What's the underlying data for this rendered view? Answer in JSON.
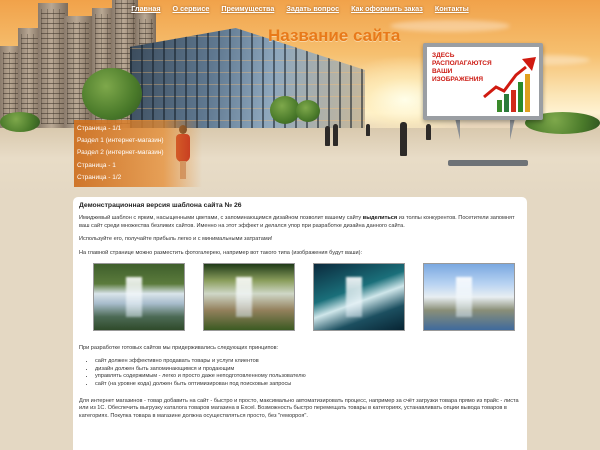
{
  "nav": {
    "items": [
      "Главная",
      "О сервисе",
      "Преимущества",
      "Задать вопрос",
      "Как оформить заказ",
      "Контакты"
    ]
  },
  "header": {
    "site_title": "Название сайта",
    "billboard_text": "Здесь располагаются ваши изображения"
  },
  "side_menu": {
    "items": [
      "Страница - 1/1",
      "Раздел 1 (интернет-магазин)",
      "Раздел 2 (интернет-магазин)",
      "Страница - 1",
      "Страница - 1/2"
    ]
  },
  "content": {
    "heading": "Демонстрационная версия шаблона сайта № 26",
    "intro_before": "Имиджевый шаблон с ярким, насыщенными цветами, с запоминающимся дизайном позволит вашему сайту ",
    "intro_bold": "выделиться",
    "intro_after": " из толпы конкурентов. Посетители запомнят ваш сайт среди множества безликих сайтов. Именно на этот эффект и делался упор при разработке дизайна данного сайта.",
    "p2": "Используйте его, получайте прибыль легко и с минимальными затратами!",
    "p3": "На главной странице можно разместить фотогалерею, например вот такого типа (изображения будут ваши):",
    "gallery_count": 4,
    "principles_intro": "При разработке готовых сайтов мы придерживались следующих принципов:",
    "principles": [
      "сайт должен эффективно продавать товары и услуги клиентов",
      "дизайн должен быть запоминающимся и продающим",
      "управлять содержимым - легко и просто даже неподготовленному пользователю",
      "сайт (на уровне кода) должен быть оптимизирован под поисковые запросы"
    ],
    "shop_paragraph": "Для интернет магазинов - товар добавить на сайт - быстро и просто, максимально автоматизировать процесс, например за счёт загрузки товара прямо из прайс - листа или из 1С. Обеспечить выгрузку каталога товаров магазина в Excel. Возможность быстро перемещать товары в категориях, устанавливать опции вывода товаров в категориях. Покупка товара в магазине должна осуществляться просто, без \"геморроя\"."
  },
  "colors": {
    "accent_orange": "#e87a1a",
    "menu_orange": "#d9822e",
    "billboard_red": "#cc1a12",
    "page_background": "#e4d8c3"
  }
}
